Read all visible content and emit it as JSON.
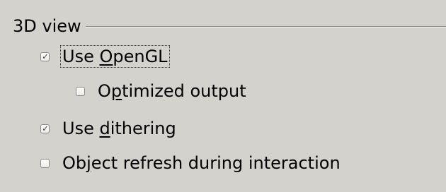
{
  "group": {
    "title": "3D view"
  },
  "options": [
    {
      "id": "use-opengl",
      "checked": true,
      "label_before": "Use ",
      "label_accel": "O",
      "label_after": "penGL",
      "focused": true
    },
    {
      "id": "optimized-output",
      "checked": false,
      "label_before": "O",
      "label_accel": "p",
      "label_after": "timized output",
      "focused": false
    },
    {
      "id": "use-dithering",
      "checked": true,
      "label_before": "Use ",
      "label_accel": "d",
      "label_after": "ithering",
      "focused": false
    },
    {
      "id": "object-refresh",
      "checked": false,
      "label_before": "Ob",
      "label_accel": "j",
      "label_after": "ect refresh during interaction",
      "focused": false
    }
  ],
  "icons": {
    "check": "checkmark-icon"
  }
}
